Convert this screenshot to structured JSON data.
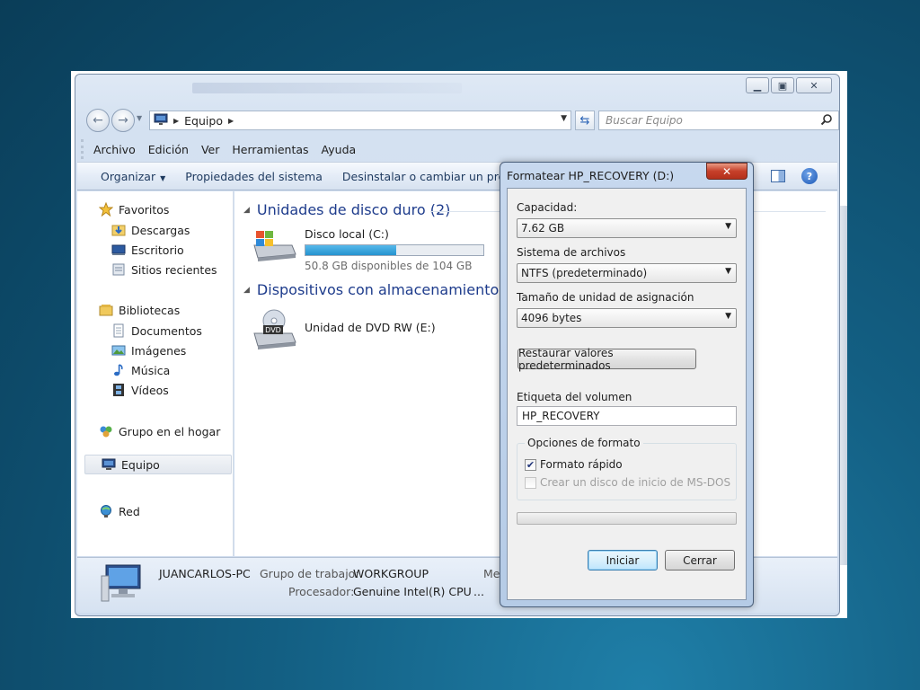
{
  "explorer": {
    "address": {
      "crumb": "Equipo"
    },
    "search": {
      "placeholder": "Buscar Equipo"
    },
    "menu": [
      "Archivo",
      "Edición",
      "Ver",
      "Herramientas",
      "Ayuda"
    ],
    "commands": {
      "organize": "Organizar",
      "system_props": "Propiedades del sistema",
      "uninstall": "Desinstalar o cambiar un progr"
    },
    "nav": {
      "favorites": "Favoritos",
      "downloads": "Descargas",
      "desktop": "Escritorio",
      "recent": "Sitios recientes",
      "libraries": "Bibliotecas",
      "documents": "Documentos",
      "images": "Imágenes",
      "music": "Música",
      "videos": "Vídeos",
      "homegroup": "Grupo en el hogar",
      "computer": "Equipo",
      "network": "Red"
    },
    "groups": {
      "hdd": "Unidades de disco duro (2)",
      "removable": "Dispositivos con almacenamiento extr"
    },
    "drives": {
      "c_name": "Disco local (C:)",
      "c_free": "50.8 GB disponibles de 104 GB",
      "c_used_fraction": 0.51,
      "dvd_name": "Unidad de DVD RW (E:)"
    },
    "details": {
      "pc_name": "JUANCARLOS-PC",
      "workgroup_label": "Grupo de trabajo:",
      "workgroup_value": "WORKGROUP",
      "cpu_label": "Procesador:",
      "cpu_value": "Genuine Intel(R) CPU",
      "mem_fragment": "Me",
      "ellipsis": "..."
    }
  },
  "dialog": {
    "title": "Formatear HP_RECOVERY (D:)",
    "capacity_label": "Capacidad:",
    "capacity_value": "7.62 GB",
    "fs_label": "Sistema de archivos",
    "fs_value": "NTFS (predeterminado)",
    "alloc_label": "Tamaño de unidad de asignación",
    "alloc_value": "4096 bytes",
    "restore_button": "Restaurar valores predeterminados",
    "volume_label": "Etiqueta del volumen",
    "volume_value": "HP_RECOVERY",
    "options_label": "Opciones de formato",
    "quick_format": "Formato rápido",
    "quick_format_checked": true,
    "msdos_disk": "Crear un disco de inicio de MS-DOS",
    "msdos_checked": false,
    "progress": 0,
    "start_button": "Iniciar",
    "close_button": "Cerrar"
  },
  "colors": {
    "desktop": "#135f83",
    "group_heading": "#1e3c8c",
    "drive_bar": "#2593cf"
  }
}
